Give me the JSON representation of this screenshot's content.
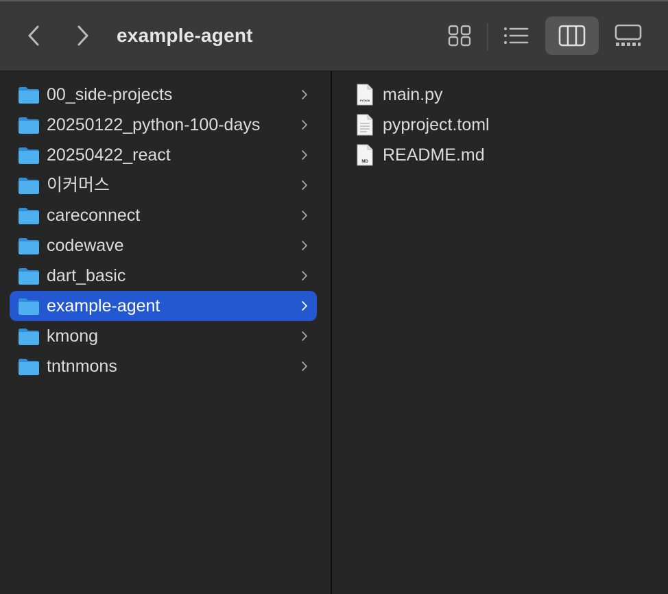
{
  "window": {
    "title": "example-agent"
  },
  "toolbar": {
    "back_icon": "chevron-left-icon",
    "forward_icon": "chevron-right-icon",
    "view_modes": [
      {
        "name": "icons",
        "icon": "grid-icon",
        "active": false
      },
      {
        "name": "list",
        "icon": "list-icon",
        "active": false
      },
      {
        "name": "columns",
        "icon": "columns-icon",
        "active": true
      },
      {
        "name": "gallery",
        "icon": "gallery-icon",
        "active": false
      }
    ]
  },
  "folders": [
    {
      "label": "00_side-projects",
      "selected": false
    },
    {
      "label": "20250122_python-100-days",
      "selected": false
    },
    {
      "label": "20250422_react",
      "selected": false
    },
    {
      "label": "이커머스",
      "selected": false
    },
    {
      "label": "careconnect",
      "selected": false
    },
    {
      "label": "codewave",
      "selected": false
    },
    {
      "label": "dart_basic",
      "selected": false
    },
    {
      "label": "example-agent",
      "selected": true
    },
    {
      "label": "kmong",
      "selected": false
    },
    {
      "label": "tntnmons",
      "selected": false
    }
  ],
  "files": [
    {
      "label": "main.py",
      "icon": "python-file-icon",
      "badge": "PYTHON"
    },
    {
      "label": "pyproject.toml",
      "icon": "text-file-icon",
      "badge": ""
    },
    {
      "label": "README.md",
      "icon": "markdown-file-icon",
      "badge": "MD"
    }
  ],
  "colors": {
    "toolbar": "#393939",
    "background": "#262626",
    "selection": "#2358d0",
    "folder": "#3fa4e8",
    "text": "#dcdcdc"
  }
}
